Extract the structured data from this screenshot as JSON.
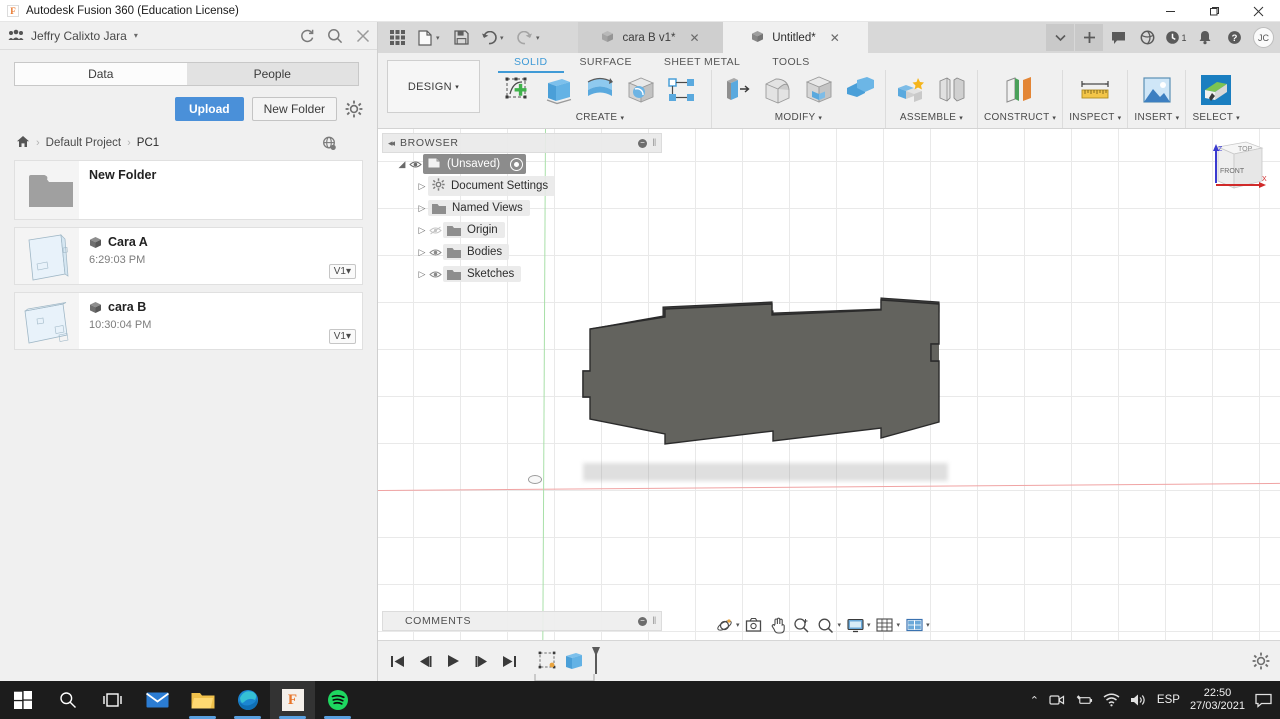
{
  "window": {
    "title": "Autodesk Fusion 360 (Education License)",
    "app_initial": "F",
    "minimize": "—",
    "maximize": "❐",
    "close": "✕"
  },
  "data_panel": {
    "user_name": "Jeffry Calixto Jara",
    "user_caret": "▾",
    "header_icons": [
      "refresh-icon",
      "search-icon",
      "close-icon"
    ],
    "tabs": [
      {
        "label": "Data",
        "active": true
      },
      {
        "label": "People",
        "active": false
      }
    ],
    "upload_label": "Upload",
    "new_folder_label": "New Folder",
    "settings_icon": "gear-icon",
    "breadcrumb": {
      "home_icon": "home-icon",
      "separator": "›",
      "items": [
        "Default Project",
        "PC1"
      ],
      "globe_icon": "globe-icon"
    },
    "items": [
      {
        "type": "folder",
        "name": "New Folder",
        "time": "",
        "version": ""
      },
      {
        "type": "design",
        "name": "Cara A",
        "time": "6:29:03 PM",
        "version": "V1"
      },
      {
        "type": "design",
        "name": "cara B",
        "time": "10:30:04 PM",
        "version": "V1"
      }
    ],
    "version_caret": "▾"
  },
  "fusion": {
    "quick_access": [
      "grid-apps-icon",
      "new-file-icon",
      "save-icon",
      "undo-icon",
      "redo-icon"
    ],
    "qat_caret": "▾",
    "document_tabs": [
      {
        "label": "cara B v1*",
        "active": false,
        "close": "✕"
      },
      {
        "label": "Untitled*",
        "active": true,
        "close": "✕"
      }
    ],
    "tab_right_icons": [
      "chevron-down-icon",
      "plus-icon",
      "comment-icon",
      "help-globe-icon",
      "job-status-icon",
      "notifications-bell-icon",
      "help-question-icon"
    ],
    "job_badge": "1",
    "avatar_initials": "JC",
    "workspace_label": "DESIGN",
    "workspace_caret": "▾",
    "ribbon_tabs": [
      {
        "label": "SOLID",
        "active": true
      },
      {
        "label": "SURFACE",
        "active": false
      },
      {
        "label": "SHEET METAL",
        "active": false
      },
      {
        "label": "TOOLS",
        "active": false
      }
    ],
    "ribbon_groups": [
      {
        "label": "CREATE",
        "caret": "▾",
        "tools": [
          "create-sketch-icon",
          "extrude-icon",
          "revolve-icon",
          "sphere-icon",
          "pattern-icon"
        ]
      },
      {
        "label": "MODIFY",
        "caret": "▾",
        "tools": [
          "press-pull-icon",
          "fillet-icon",
          "shell-icon",
          "combine-icon"
        ]
      },
      {
        "label": "ASSEMBLE",
        "caret": "▾",
        "tools": [
          "new-component-icon",
          "joint-icon"
        ]
      },
      {
        "label": "CONSTRUCT",
        "caret": "▾",
        "tools": [
          "offset-plane-icon"
        ]
      },
      {
        "label": "INSPECT",
        "caret": "▾",
        "tools": [
          "measure-icon"
        ]
      },
      {
        "label": "INSERT",
        "caret": "▾",
        "tools": [
          "insert-image-icon"
        ]
      },
      {
        "label": "SELECT",
        "caret": "▾",
        "tools": [
          "select-icon"
        ]
      }
    ],
    "browser": {
      "title": "BROWSER",
      "collapse_icon": "◂◂",
      "minimize_icon": "−",
      "grip_icon": "‖",
      "rows": [
        {
          "label": "(Unsaved)",
          "indent": 0,
          "selected": true,
          "twisty": "◢",
          "eye": true,
          "icon": "document-icon",
          "radio": true
        },
        {
          "label": "Document Settings",
          "indent": 1,
          "selected": false,
          "twisty": "▷",
          "eye": false,
          "icon": "gear-icon",
          "radio": false
        },
        {
          "label": "Named Views",
          "indent": 1,
          "selected": false,
          "twisty": "▷",
          "eye": false,
          "icon": "folder-icon",
          "radio": false
        },
        {
          "label": "Origin",
          "indent": 1,
          "selected": false,
          "twisty": "▷",
          "eye": true,
          "eye_off": true,
          "icon": "folder-icon",
          "radio": false
        },
        {
          "label": "Bodies",
          "indent": 1,
          "selected": false,
          "twisty": "▷",
          "eye": true,
          "icon": "folder-icon",
          "radio": false
        },
        {
          "label": "Sketches",
          "indent": 1,
          "selected": false,
          "twisty": "▷",
          "eye": true,
          "icon": "folder-icon",
          "radio": false
        }
      ]
    },
    "comments": {
      "title": "COMMENTS",
      "minimize_icon": "−",
      "grip_icon": "‖"
    },
    "view_tools": [
      {
        "icon": "orbit-icon",
        "caret": "▾"
      },
      {
        "icon": "look-at-icon",
        "caret": ""
      },
      {
        "icon": "pan-icon",
        "caret": ""
      },
      {
        "icon": "zoom-icon",
        "caret": ""
      },
      {
        "icon": "fit-icon",
        "caret": "▾"
      },
      {
        "icon": "display-settings-icon",
        "caret": "▾"
      },
      {
        "icon": "grid-snaps-icon",
        "caret": "▾"
      },
      {
        "icon": "viewports-icon",
        "caret": "▾"
      }
    ],
    "view_cube": {
      "top_label": "TOP",
      "front_label": "FRONT",
      "z_label": "Z",
      "x_label": "X"
    },
    "timeline": {
      "nav": [
        "go-to-beginning-icon",
        "step-back-icon",
        "play-icon",
        "step-forward-icon",
        "go-to-end-icon"
      ],
      "features": [
        "sketch-feature-icon",
        "extrude-feature-icon"
      ],
      "settings_icon": "gear-icon"
    }
  },
  "taskbar": {
    "items": [
      {
        "icon": "windows-start-icon",
        "active": false
      },
      {
        "icon": "search-icon",
        "active": false
      },
      {
        "icon": "task-view-icon",
        "active": false
      },
      {
        "icon": "mail-icon",
        "active": false
      },
      {
        "icon": "file-explorer-icon",
        "active": false,
        "running": true
      },
      {
        "icon": "microsoft-edge-icon",
        "active": false,
        "running": true
      },
      {
        "icon": "fusion360-icon",
        "active": true,
        "running": true
      },
      {
        "icon": "spotify-icon",
        "active": false,
        "running": true
      }
    ],
    "tray": {
      "chevron": "⌃",
      "icons": [
        "webcam-icon",
        "pen-battery-icon",
        "wifi-icon",
        "volume-icon"
      ],
      "language": "ESP",
      "time": "22:50",
      "date": "27/03/2021",
      "action_center_icon": "notification-center-icon"
    }
  }
}
